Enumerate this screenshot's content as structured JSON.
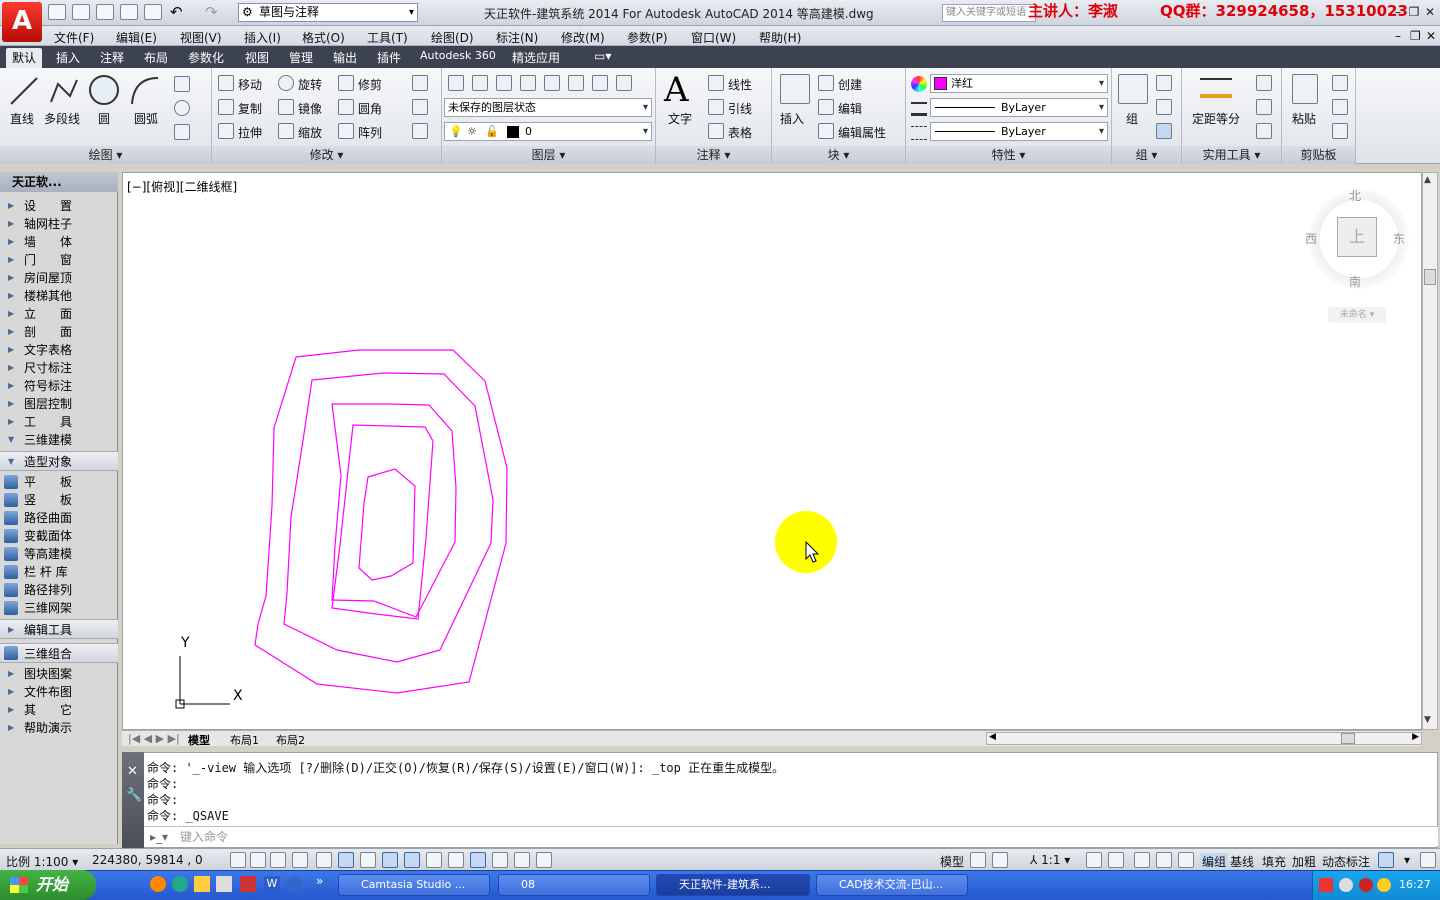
{
  "titlebar": {
    "logo": "A",
    "workspace": "草图与注释",
    "title": "天正软件-建筑系统 2014 For Autodesk AutoCAD 2014    等高建模.dwg",
    "search_placeholder": "键入关键字或短语",
    "presenter": "主讲人：李淑",
    "qq": "QQ群：329924658，15310023"
  },
  "menubar": {
    "items": [
      "文件(F)",
      "编辑(E)",
      "视图(V)",
      "插入(I)",
      "格式(O)",
      "工具(T)",
      "绘图(D)",
      "标注(N)",
      "修改(M)",
      "参数(P)",
      "窗口(W)",
      "帮助(H)"
    ]
  },
  "ribbon_tabs": [
    "默认",
    "插入",
    "注释",
    "布局",
    "参数化",
    "视图",
    "管理",
    "输出",
    "插件",
    "Autodesk 360",
    "精选应用"
  ],
  "ribbon": {
    "draw": {
      "title": "绘图",
      "line": "直线",
      "polyline": "多段线",
      "circle": "圆",
      "arc": "圆弧"
    },
    "modify": {
      "title": "修改",
      "move": "移动",
      "rotate": "旋转",
      "trim": "修剪",
      "copy": "复制",
      "mirror": "镜像",
      "fillet": "圆角",
      "stretch": "拉伸",
      "scale": "缩放",
      "array": "阵列"
    },
    "layers": {
      "title": "图层",
      "state": "未保存的图层状态",
      "current": "0"
    },
    "annotation": {
      "title": "注释",
      "text": "文字",
      "linear": "线性",
      "leader": "引线",
      "table": "表格"
    },
    "block": {
      "title": "块",
      "insert": "插入",
      "create": "创建",
      "edit": "编辑",
      "edit_attr": "编辑属性"
    },
    "properties": {
      "title": "特性",
      "color": "洋红",
      "linetype": "ByLayer",
      "lineweight": "ByLayer"
    },
    "groups": {
      "title": "组",
      "group": "组"
    },
    "utilities": {
      "title": "实用工具",
      "measure": "定距等分"
    },
    "clipboard": {
      "title": "剪贴板",
      "paste": "粘贴"
    }
  },
  "palette": {
    "title": "天正软...",
    "items": [
      "设　　置",
      "轴网柱子",
      "墙　　体",
      "门　　窗",
      "房间屋顶",
      "楼梯其他",
      "立　　面",
      "剖　　面",
      "文字表格",
      "尺寸标注",
      "符号标注",
      "图层控制",
      "工　　具",
      "三维建模"
    ],
    "section": "造型对象",
    "sub_items": [
      "平　　板",
      "竖　　板",
      "路径曲面",
      "变截面体",
      "等高建模",
      "栏 杆 库",
      "路径排列",
      "三维网架"
    ],
    "edit_tools": "编辑工具",
    "combo": "三维组合",
    "tail_items": [
      "图块图案",
      "文件布图",
      "其　　它",
      "帮助演示"
    ]
  },
  "viewport": {
    "label": "[−][俯视][二维线框]",
    "compass": {
      "north": "北",
      "south": "南",
      "east": "东",
      "west": "西",
      "top": "上"
    },
    "wcs": "未命名",
    "axis_x": "X",
    "axis_y": "Y"
  },
  "layout_tabs": [
    "模型",
    "布局1",
    "布局2"
  ],
  "command": {
    "lines": [
      "命令: '_-view 输入选项 [?/删除(D)/正交(O)/恢复(R)/保存(S)/设置(E)/窗口(W)]: _top 正在重生成模型。",
      "命令:",
      "命令:",
      "命令: _QSAVE"
    ],
    "placeholder": "键入命令"
  },
  "statusbar": {
    "scale": "比例 1:100",
    "coords": "224380, 59814 , 0",
    "model": "模型",
    "anno_scale": "1:1",
    "toggles": [
      "编组",
      "基线",
      "填充",
      "加粗",
      "动态标注"
    ]
  },
  "taskbar": {
    "start": "开始",
    "tasks": [
      "Camtasia Studio ...",
      "08",
      "天正软件-建筑系...",
      "CAD技术交流-巴山..."
    ],
    "time": "16:27"
  },
  "colors": {
    "contour": "#ff00ff",
    "highlight": "#ffff00",
    "ribbon_dark": "#3d4250"
  }
}
